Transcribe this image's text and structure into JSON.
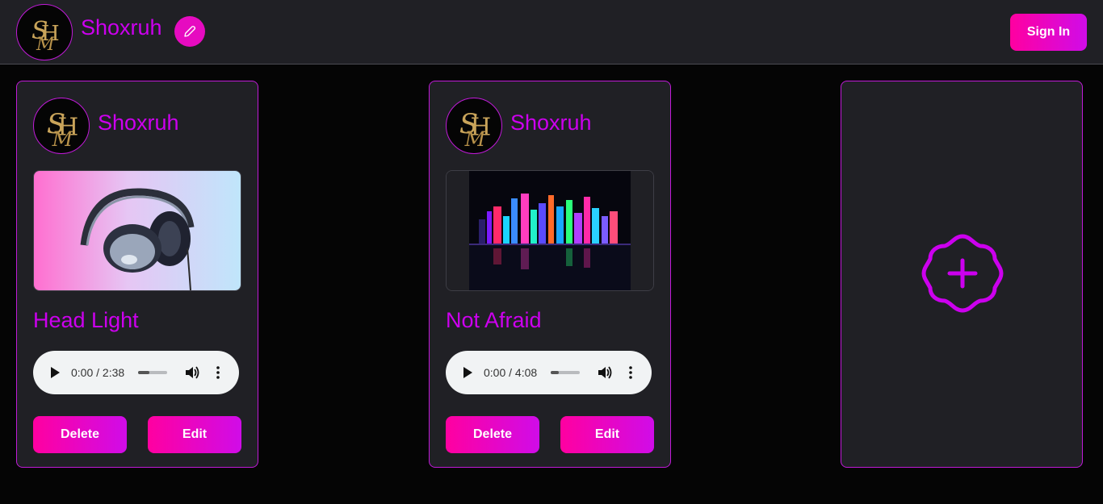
{
  "header": {
    "username": "Shoxruh",
    "avatar_monogram": "SMH",
    "sign_in_label": "Sign In",
    "edit_icon": "pencil-icon"
  },
  "colors": {
    "accent": "#cc00ee",
    "button_gradient_start": "#ff00a0",
    "button_gradient_end": "#d00ce8",
    "surface": "#202025",
    "background": "#050505"
  },
  "cards": [
    {
      "author": "Shoxruh",
      "title": "Head Light",
      "cover": "headphones-image",
      "player": {
        "time": "0:00 / 2:38",
        "progress": 0
      },
      "delete_label": "Delete",
      "edit_label": "Edit"
    },
    {
      "author": "Shoxruh",
      "title": "Not Afraid",
      "cover": "neon-city-image",
      "player": {
        "time": "0:00 / 4:08",
        "progress": 0
      },
      "delete_label": "Delete",
      "edit_label": "Edit"
    }
  ],
  "add_card": {
    "icon": "add-badge-icon"
  }
}
